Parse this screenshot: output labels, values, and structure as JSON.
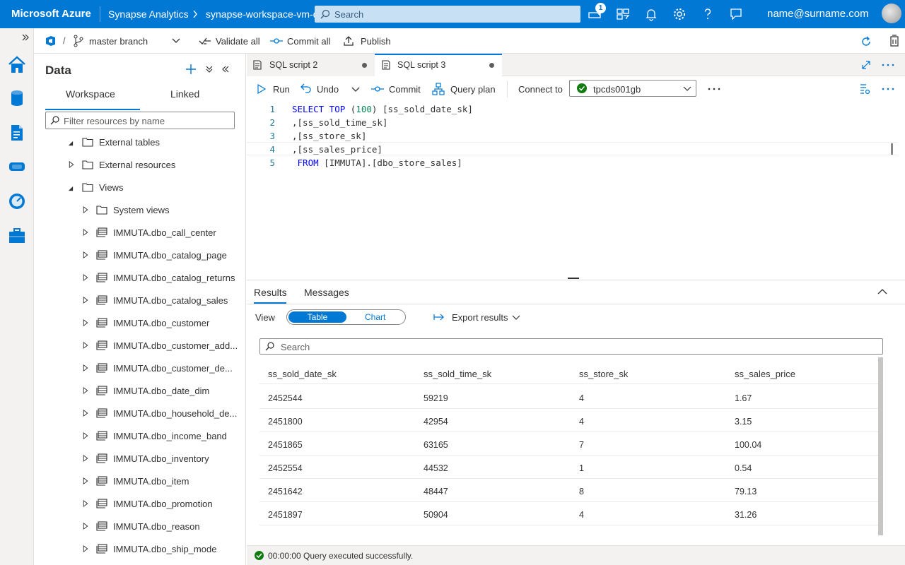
{
  "topbar": {
    "brand": "Microsoft Azure",
    "service": "Synapse Analytics",
    "workspace": "synapse-workspace-vm-demo",
    "search_placeholder": "Search",
    "notification_count": "1",
    "user": "name@surname.com",
    "accent": "#0078d4"
  },
  "toolbar": {
    "branch": "master branch",
    "validate_all": "Validate all",
    "commit_all": "Commit all",
    "publish": "Publish"
  },
  "data_panel": {
    "title": "Data",
    "tabs": [
      "Workspace",
      "Linked"
    ],
    "filter_placeholder": "Filter resources by name",
    "tree": [
      {
        "label": "External tables",
        "kind": "folder",
        "expanded": true,
        "level": 0
      },
      {
        "label": "External resources",
        "kind": "folder",
        "expanded": false,
        "level": 0
      },
      {
        "label": "Views",
        "kind": "folder",
        "expanded": true,
        "level": 0
      },
      {
        "label": "System views",
        "kind": "folder",
        "expanded": false,
        "level": 1
      },
      {
        "label": "IMMUTA.dbo_call_center",
        "kind": "view",
        "level": 1
      },
      {
        "label": "IMMUTA.dbo_catalog_page",
        "kind": "view",
        "level": 1
      },
      {
        "label": "IMMUTA.dbo_catalog_returns",
        "kind": "view",
        "level": 1
      },
      {
        "label": "IMMUTA.dbo_catalog_sales",
        "kind": "view",
        "level": 1
      },
      {
        "label": "IMMUTA.dbo_customer",
        "kind": "view",
        "level": 1
      },
      {
        "label": "IMMUTA.dbo_customer_add...",
        "kind": "view",
        "level": 1
      },
      {
        "label": "IMMUTA.dbo_customer_de...",
        "kind": "view",
        "level": 1
      },
      {
        "label": "IMMUTA.dbo_date_dim",
        "kind": "view",
        "level": 1
      },
      {
        "label": "IMMUTA.dbo_household_de...",
        "kind": "view",
        "level": 1
      },
      {
        "label": "IMMUTA.dbo_income_band",
        "kind": "view",
        "level": 1
      },
      {
        "label": "IMMUTA.dbo_inventory",
        "kind": "view",
        "level": 1
      },
      {
        "label": "IMMUTA.dbo_item",
        "kind": "view",
        "level": 1
      },
      {
        "label": "IMMUTA.dbo_promotion",
        "kind": "view",
        "level": 1
      },
      {
        "label": "IMMUTA.dbo_reason",
        "kind": "view",
        "level": 1
      },
      {
        "label": "IMMUTA.dbo_ship_mode",
        "kind": "view",
        "level": 1
      }
    ]
  },
  "editor": {
    "tabs": [
      {
        "label": "SQL script 2",
        "active": false
      },
      {
        "label": "SQL script 3",
        "active": true
      }
    ],
    "run": "Run",
    "undo": "Undo",
    "commit": "Commit",
    "query_plan": "Query plan",
    "connect_to": "Connect to",
    "connection": "tpcds001gb",
    "lines": [
      {
        "num": "1",
        "kw": "SELECT TOP",
        "paren_open": " (",
        "number": "100",
        "rest": ") [ss_sold_date_sk]"
      },
      {
        "num": "2",
        "text": ",[ss_sold_time_sk]"
      },
      {
        "num": "3",
        "text": ",[ss_store_sk]"
      },
      {
        "num": "4",
        "text": ",[ss_sales_price]"
      },
      {
        "num": "5",
        "kw": " FROM",
        "rest": " [IMMUTA].[dbo_store_sales]"
      }
    ]
  },
  "results": {
    "tabs": [
      "Results",
      "Messages"
    ],
    "view_label": "View",
    "view_table": "Table",
    "view_chart": "Chart",
    "export": "Export results",
    "search_placeholder": "Search",
    "columns": [
      "ss_sold_date_sk",
      "ss_sold_time_sk",
      "ss_store_sk",
      "ss_sales_price"
    ],
    "rows": [
      [
        "2452544",
        "59219",
        "4",
        "1.67"
      ],
      [
        "2451800",
        "42954",
        "4",
        "3.15"
      ],
      [
        "2451865",
        "63165",
        "7",
        "100.04"
      ],
      [
        "2452554",
        "44532",
        "1",
        "0.54"
      ],
      [
        "2451642",
        "48447",
        "8",
        "79.13"
      ],
      [
        "2451897",
        "50904",
        "4",
        "31.26"
      ]
    ]
  },
  "status": {
    "text": "00:00:00 Query executed successfully.",
    "ok_color": "#107c10"
  }
}
